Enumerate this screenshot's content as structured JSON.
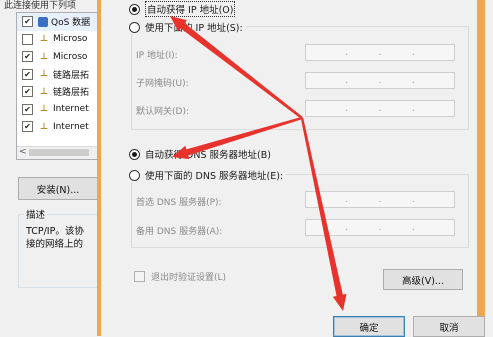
{
  "background_dialog": {
    "heading": "此连接使用下列项",
    "items": [
      {
        "label": "QoS 数据",
        "checked": true,
        "icon": "qos-icon"
      },
      {
        "label": "Microso",
        "checked": false,
        "icon": "protocol-icon"
      },
      {
        "label": "Microso",
        "checked": true,
        "icon": "protocol-icon"
      },
      {
        "label": "链路层拓",
        "checked": true,
        "icon": "protocol-icon"
      },
      {
        "label": "链路层拓",
        "checked": true,
        "icon": "protocol-icon"
      },
      {
        "label": "Internet",
        "checked": true,
        "icon": "protocol-icon"
      },
      {
        "label": "Internet",
        "checked": true,
        "icon": "protocol-icon"
      }
    ],
    "install_button": "安装(N)...",
    "description_title": "描述",
    "description_lines": [
      "TCP/IP。该协",
      "接的网络上的"
    ]
  },
  "ip_section": {
    "auto_ip": "自动获得 IP 地址(O)",
    "manual_ip": "使用下面的 IP 地址(S):",
    "ip_address_label": "IP 地址(I):",
    "subnet_label": "子网掩码(U):",
    "gateway_label": "默认网关(D):"
  },
  "dns_section": {
    "auto_dns": "自动获得 DNS 服务器地址(B)",
    "manual_dns": "使用下面的 DNS 服务器地址(E):",
    "preferred_label": "首选 DNS 服务器(P):",
    "alternate_label": "备用 DNS 服务器(A):"
  },
  "validate_on_exit": "退出时验证设置(L)",
  "advanced_button": "高级(V)...",
  "ok_button": "确定",
  "cancel_button": "取消",
  "colors": {
    "annotation_arrow": "#e8322c",
    "window_border": "#f0a550"
  }
}
